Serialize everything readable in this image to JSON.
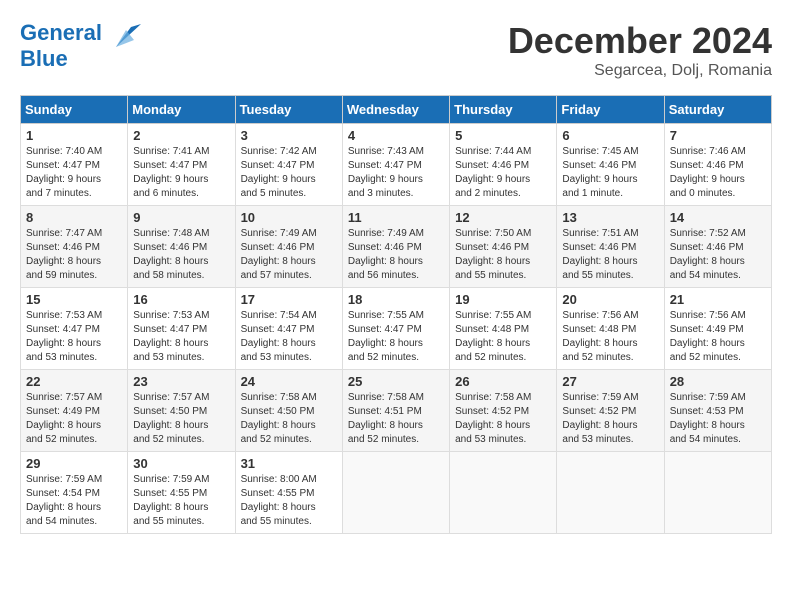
{
  "header": {
    "logo": {
      "general": "General",
      "blue": "Blue"
    },
    "title": "December 2024",
    "location": "Segarcea, Dolj, Romania"
  },
  "calendar": {
    "days_of_week": [
      "Sunday",
      "Monday",
      "Tuesday",
      "Wednesday",
      "Thursday",
      "Friday",
      "Saturday"
    ],
    "weeks": [
      [
        {
          "day": "1",
          "info": "Sunrise: 7:40 AM\nSunset: 4:47 PM\nDaylight: 9 hours\nand 7 minutes."
        },
        {
          "day": "2",
          "info": "Sunrise: 7:41 AM\nSunset: 4:47 PM\nDaylight: 9 hours\nand 6 minutes."
        },
        {
          "day": "3",
          "info": "Sunrise: 7:42 AM\nSunset: 4:47 PM\nDaylight: 9 hours\nand 5 minutes."
        },
        {
          "day": "4",
          "info": "Sunrise: 7:43 AM\nSunset: 4:47 PM\nDaylight: 9 hours\nand 3 minutes."
        },
        {
          "day": "5",
          "info": "Sunrise: 7:44 AM\nSunset: 4:46 PM\nDaylight: 9 hours\nand 2 minutes."
        },
        {
          "day": "6",
          "info": "Sunrise: 7:45 AM\nSunset: 4:46 PM\nDaylight: 9 hours\nand 1 minute."
        },
        {
          "day": "7",
          "info": "Sunrise: 7:46 AM\nSunset: 4:46 PM\nDaylight: 9 hours\nand 0 minutes."
        }
      ],
      [
        {
          "day": "8",
          "info": "Sunrise: 7:47 AM\nSunset: 4:46 PM\nDaylight: 8 hours\nand 59 minutes."
        },
        {
          "day": "9",
          "info": "Sunrise: 7:48 AM\nSunset: 4:46 PM\nDaylight: 8 hours\nand 58 minutes."
        },
        {
          "day": "10",
          "info": "Sunrise: 7:49 AM\nSunset: 4:46 PM\nDaylight: 8 hours\nand 57 minutes."
        },
        {
          "day": "11",
          "info": "Sunrise: 7:49 AM\nSunset: 4:46 PM\nDaylight: 8 hours\nand 56 minutes."
        },
        {
          "day": "12",
          "info": "Sunrise: 7:50 AM\nSunset: 4:46 PM\nDaylight: 8 hours\nand 55 minutes."
        },
        {
          "day": "13",
          "info": "Sunrise: 7:51 AM\nSunset: 4:46 PM\nDaylight: 8 hours\nand 55 minutes."
        },
        {
          "day": "14",
          "info": "Sunrise: 7:52 AM\nSunset: 4:46 PM\nDaylight: 8 hours\nand 54 minutes."
        }
      ],
      [
        {
          "day": "15",
          "info": "Sunrise: 7:53 AM\nSunset: 4:47 PM\nDaylight: 8 hours\nand 53 minutes."
        },
        {
          "day": "16",
          "info": "Sunrise: 7:53 AM\nSunset: 4:47 PM\nDaylight: 8 hours\nand 53 minutes."
        },
        {
          "day": "17",
          "info": "Sunrise: 7:54 AM\nSunset: 4:47 PM\nDaylight: 8 hours\nand 53 minutes."
        },
        {
          "day": "18",
          "info": "Sunrise: 7:55 AM\nSunset: 4:47 PM\nDaylight: 8 hours\nand 52 minutes."
        },
        {
          "day": "19",
          "info": "Sunrise: 7:55 AM\nSunset: 4:48 PM\nDaylight: 8 hours\nand 52 minutes."
        },
        {
          "day": "20",
          "info": "Sunrise: 7:56 AM\nSunset: 4:48 PM\nDaylight: 8 hours\nand 52 minutes."
        },
        {
          "day": "21",
          "info": "Sunrise: 7:56 AM\nSunset: 4:49 PM\nDaylight: 8 hours\nand 52 minutes."
        }
      ],
      [
        {
          "day": "22",
          "info": "Sunrise: 7:57 AM\nSunset: 4:49 PM\nDaylight: 8 hours\nand 52 minutes."
        },
        {
          "day": "23",
          "info": "Sunrise: 7:57 AM\nSunset: 4:50 PM\nDaylight: 8 hours\nand 52 minutes."
        },
        {
          "day": "24",
          "info": "Sunrise: 7:58 AM\nSunset: 4:50 PM\nDaylight: 8 hours\nand 52 minutes."
        },
        {
          "day": "25",
          "info": "Sunrise: 7:58 AM\nSunset: 4:51 PM\nDaylight: 8 hours\nand 52 minutes."
        },
        {
          "day": "26",
          "info": "Sunrise: 7:58 AM\nSunset: 4:52 PM\nDaylight: 8 hours\nand 53 minutes."
        },
        {
          "day": "27",
          "info": "Sunrise: 7:59 AM\nSunset: 4:52 PM\nDaylight: 8 hours\nand 53 minutes."
        },
        {
          "day": "28",
          "info": "Sunrise: 7:59 AM\nSunset: 4:53 PM\nDaylight: 8 hours\nand 54 minutes."
        }
      ],
      [
        {
          "day": "29",
          "info": "Sunrise: 7:59 AM\nSunset: 4:54 PM\nDaylight: 8 hours\nand 54 minutes."
        },
        {
          "day": "30",
          "info": "Sunrise: 7:59 AM\nSunset: 4:55 PM\nDaylight: 8 hours\nand 55 minutes."
        },
        {
          "day": "31",
          "info": "Sunrise: 8:00 AM\nSunset: 4:55 PM\nDaylight: 8 hours\nand 55 minutes."
        },
        {
          "day": "",
          "info": ""
        },
        {
          "day": "",
          "info": ""
        },
        {
          "day": "",
          "info": ""
        },
        {
          "day": "",
          "info": ""
        }
      ]
    ]
  }
}
